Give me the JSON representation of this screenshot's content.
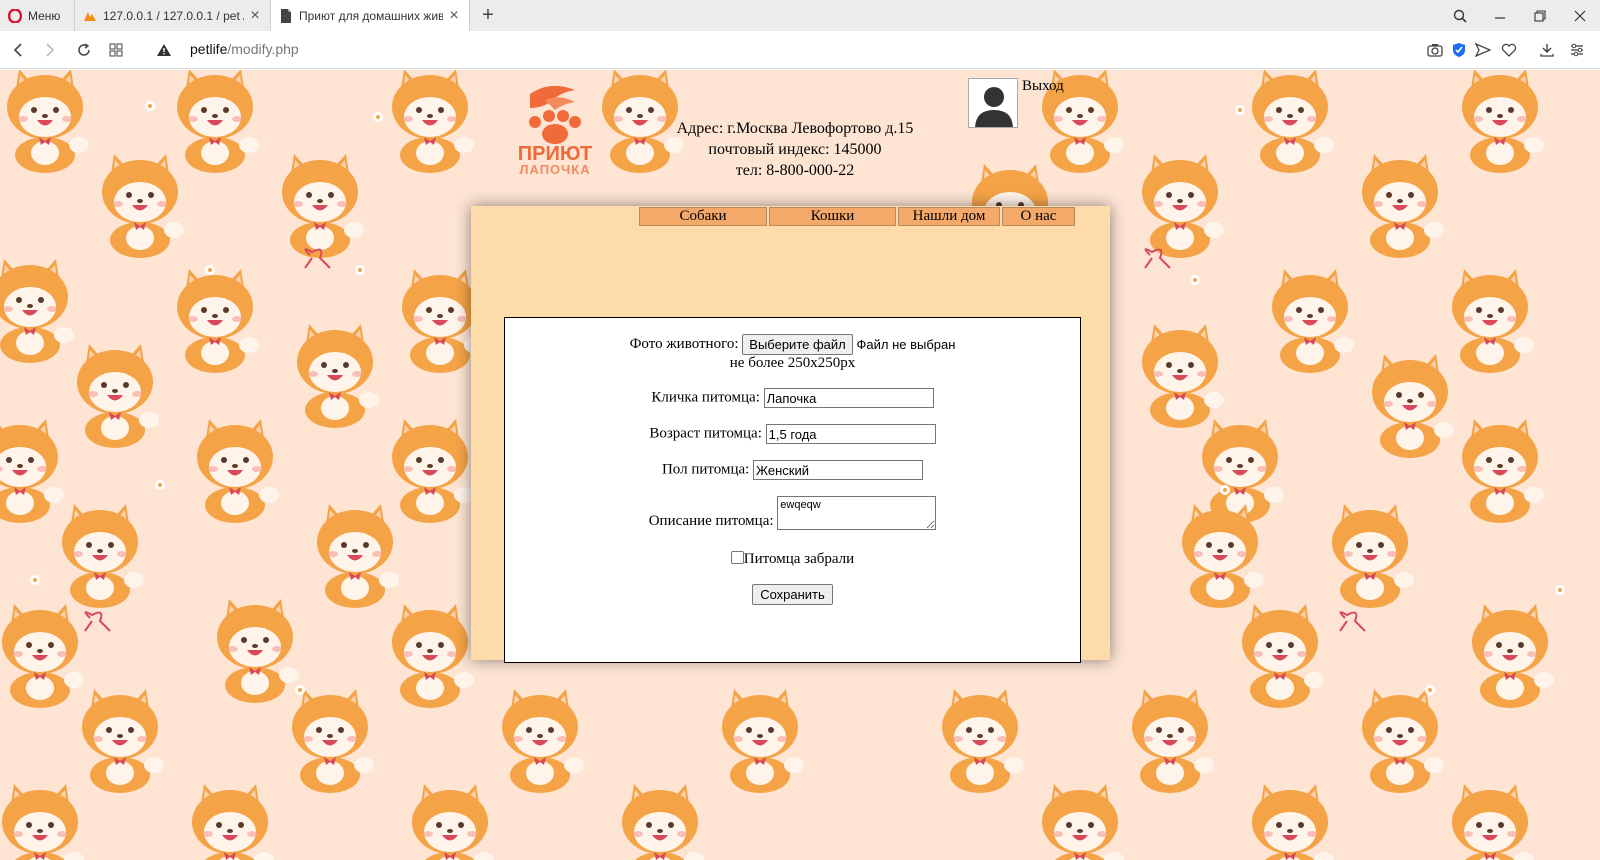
{
  "browser": {
    "menu_label": "Меню",
    "tabs": [
      {
        "title": "127.0.0.1 / 127.0.0.1 / pet /"
      },
      {
        "title": "Приют для домашних жив"
      }
    ],
    "url_host": "petlife",
    "url_path": "/modify.php"
  },
  "header": {
    "address_lines": [
      "Адрес: г.Москва Левофортово д.15",
      "почтовый индекс: 145000",
      "тел: 8-800-000-22"
    ],
    "logout": "Выход",
    "logo_text_top": "ПРИЮТ",
    "logo_text_bottom": "ЛАПОЧКА"
  },
  "nav": {
    "items": [
      {
        "label": "Собаки"
      },
      {
        "label": "Кошки"
      },
      {
        "label": "Нашли дом"
      },
      {
        "label": "О нас"
      }
    ]
  },
  "form": {
    "photo_label": "Фото животного:",
    "file_button": "Выберите файл",
    "file_status": "Файл не выбран",
    "photo_hint": "не более 250x250px",
    "name_label": "Кличка питомца:",
    "name_value": "Лапочка",
    "age_label": "Возраст питомца:",
    "age_value": "1,5 года",
    "sex_label": "Пол питомца:",
    "sex_value": "Женский",
    "desc_label": "Описание питомца:",
    "desc_value": "ewqeqw",
    "taken_label": "Питомца забрали",
    "taken_checked": false,
    "save_button": "Сохранить"
  },
  "colors": {
    "page_bg": "#fde4d3",
    "panel_bg": "#fedcaa",
    "nav_bg": "#f4a86a",
    "dog_orange": "#f4a347",
    "logo_orange": "#f06a3a"
  }
}
